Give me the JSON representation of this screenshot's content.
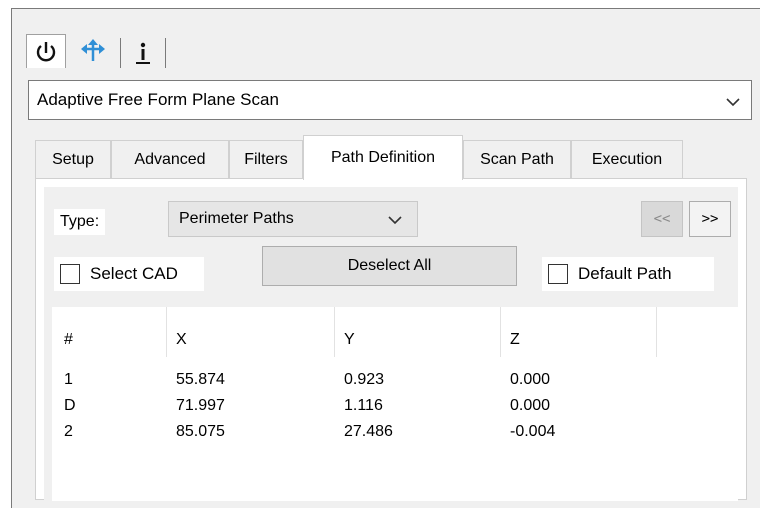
{
  "icon_tabs": [
    {
      "name": "power-icon"
    },
    {
      "name": "move-icon"
    },
    {
      "name": "info-icon"
    }
  ],
  "mode_select": {
    "value": "Adaptive Free Form Plane Scan"
  },
  "tabs": [
    {
      "label": "Setup"
    },
    {
      "label": "Advanced"
    },
    {
      "label": "Filters"
    },
    {
      "label": "Path Definition"
    },
    {
      "label": "Scan Path"
    },
    {
      "label": "Execution"
    }
  ],
  "path_definition": {
    "type_label": "Type:",
    "type_value": "Perimeter Paths",
    "prev_label": "<<",
    "next_label": ">>",
    "select_cad_label": "Select CAD",
    "deselect_all_label": "Deselect All",
    "default_path_label": "Default Path",
    "table": {
      "headers": [
        "#",
        "X",
        "Y",
        "Z"
      ],
      "rows": [
        [
          "1",
          "55.874",
          "0.923",
          "0.000"
        ],
        [
          "D",
          "71.997",
          "1.116",
          "0.000"
        ],
        [
          "2",
          "85.075",
          "27.486",
          "-0.004"
        ]
      ]
    }
  },
  "colors": {
    "move_icon": "#2f8fd6",
    "panel_bg": "#f0f0f0"
  }
}
